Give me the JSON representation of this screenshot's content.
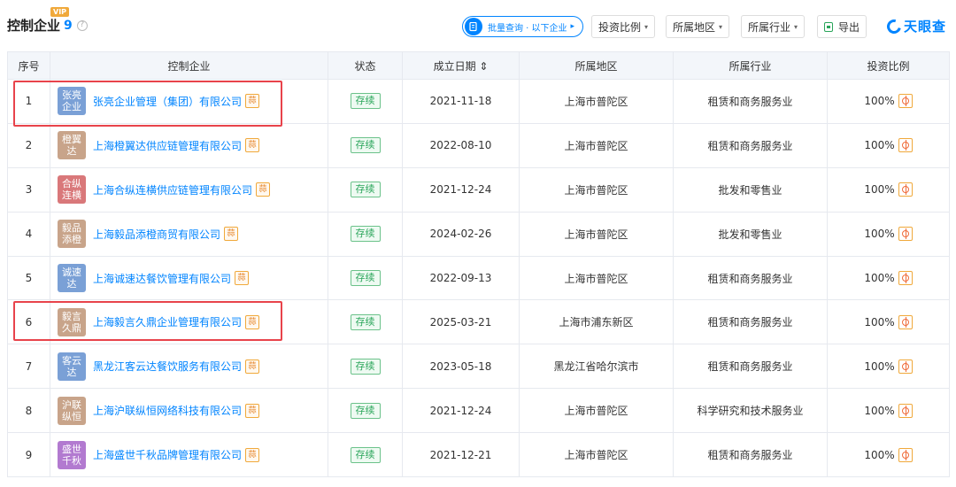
{
  "header": {
    "title": "控制企业",
    "count": "9",
    "vip": "VIP",
    "help": "?",
    "batch_query": "批量查询 · 以下企业",
    "invest_ratio": "投资比例",
    "region": "所属地区",
    "industry": "所属行业",
    "export": "导出",
    "logo": "天眼查"
  },
  "table": {
    "columns": [
      "序号",
      "控制企业",
      "状态",
      "成立日期 ⇕",
      "所属地区",
      "所属行业",
      "投资比例"
    ],
    "rows": [
      {
        "no": "1",
        "logo": "张亮企业",
        "logo_color": "#7aa0d6",
        "name": "张亮企业管理（集团）有限公司",
        "status": "存续",
        "date": "2021-11-18",
        "region": "上海市普陀区",
        "industry": "租赁和商务服务业",
        "ratio": "100%"
      },
      {
        "no": "2",
        "logo": "橙翼达",
        "logo_color": "#c8a48a",
        "name": "上海橙翼达供应链管理有限公司",
        "status": "存续",
        "date": "2022-08-10",
        "region": "上海市普陀区",
        "industry": "租赁和商务服务业",
        "ratio": "100%"
      },
      {
        "no": "3",
        "logo": "合纵连横",
        "logo_color": "#d9787a",
        "name": "上海合纵连横供应链管理有限公司",
        "status": "存续",
        "date": "2021-12-24",
        "region": "上海市普陀区",
        "industry": "批发和零售业",
        "ratio": "100%"
      },
      {
        "no": "4",
        "logo": "毅品添橙",
        "logo_color": "#c8a48a",
        "name": "上海毅品添橙商贸有限公司",
        "status": "存续",
        "date": "2024-02-26",
        "region": "上海市普陀区",
        "industry": "批发和零售业",
        "ratio": "100%"
      },
      {
        "no": "5",
        "logo": "诚速达",
        "logo_color": "#7aa0d6",
        "name": "上海诚速达餐饮管理有限公司",
        "status": "存续",
        "date": "2022-09-13",
        "region": "上海市普陀区",
        "industry": "租赁和商务服务业",
        "ratio": "100%"
      },
      {
        "no": "6",
        "logo": "毅言久鼎",
        "logo_color": "#c8a48a",
        "name": "上海毅言久鼎企业管理有限公司",
        "status": "存续",
        "date": "2025-03-21",
        "region": "上海市浦东新区",
        "industry": "租赁和商务服务业",
        "ratio": "100%"
      },
      {
        "no": "7",
        "logo": "客云达",
        "logo_color": "#7aa0d6",
        "name": "黑龙江客云达餐饮服务有限公司",
        "status": "存续",
        "date": "2023-05-18",
        "region": "黑龙江省哈尔滨市",
        "industry": "租赁和商务服务业",
        "ratio": "100%"
      },
      {
        "no": "8",
        "logo": "沪联纵恒",
        "logo_color": "#c8a48a",
        "name": "上海沪联纵恒网络科技有限公司",
        "status": "存续",
        "date": "2021-12-24",
        "region": "上海市普陀区",
        "industry": "科学研究和技术服务业",
        "ratio": "100%"
      },
      {
        "no": "9",
        "logo": "盛世千秋",
        "logo_color": "#b27ad0",
        "name": "上海盛世千秋品牌管理有限公司",
        "status": "存续",
        "date": "2021-12-21",
        "region": "上海市普陀区",
        "industry": "租赁和商务服务业",
        "ratio": "100%"
      }
    ]
  },
  "tag_label": "蒜",
  "colors": {
    "accent": "#0084ff",
    "highlight": "#e8434b",
    "status_green": "#2aa55a"
  }
}
